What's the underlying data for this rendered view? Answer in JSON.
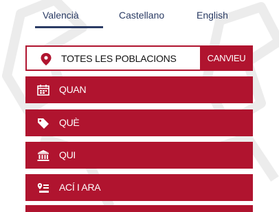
{
  "languages": [
    {
      "label": "Valencià",
      "active": true
    },
    {
      "label": "Castellano",
      "active": false
    },
    {
      "label": "English",
      "active": false
    }
  ],
  "location": {
    "icon": "map-pin-icon",
    "label": "TOTES LES POBLACIONS",
    "button_label": "CANVIEU"
  },
  "menu": [
    {
      "icon": "calendar-icon",
      "label": "QUAN"
    },
    {
      "icon": "tag-icon",
      "label": "QUÈ"
    },
    {
      "icon": "institution-icon",
      "label": "QUI"
    },
    {
      "icon": "here-and-now-icon",
      "label": "ACÍ I ARA"
    }
  ],
  "colors": {
    "accent": "#b0142f",
    "nav_text": "#2a3b64",
    "background": "#ffffff"
  }
}
